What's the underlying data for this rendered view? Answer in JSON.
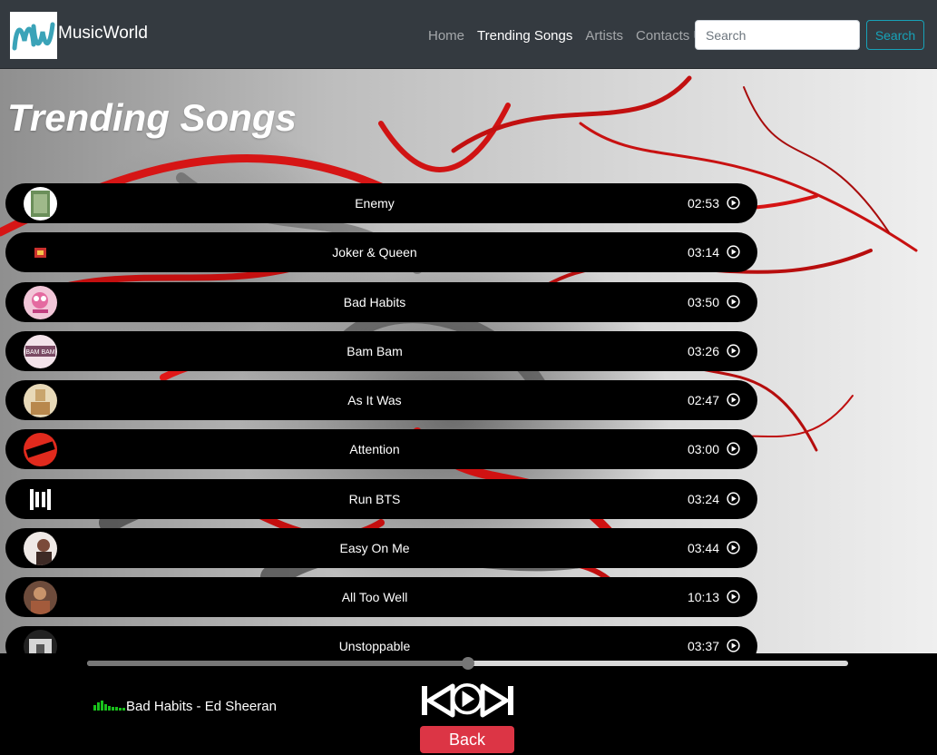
{
  "brand": {
    "name": "MusicWorld",
    "logo_text": "MW"
  },
  "nav": {
    "links": [
      {
        "label": "Home",
        "active": false
      },
      {
        "label": "Trending Songs",
        "active": true
      },
      {
        "label": "Artists",
        "active": false
      },
      {
        "label": "Contacts Us",
        "active": false
      }
    ],
    "search_placeholder": "Search",
    "search_button": "Search"
  },
  "page": {
    "title": "Trending Songs"
  },
  "songs": [
    {
      "title": "Enemy",
      "duration": "02:53"
    },
    {
      "title": "Joker & Queen",
      "duration": "03:14"
    },
    {
      "title": "Bad Habits",
      "duration": "03:50"
    },
    {
      "title": "Bam Bam",
      "duration": "03:26"
    },
    {
      "title": "As It Was",
      "duration": "02:47"
    },
    {
      "title": "Attention",
      "duration": "03:00"
    },
    {
      "title": "Run BTS",
      "duration": "03:24"
    },
    {
      "title": "Easy On Me",
      "duration": "03:44"
    },
    {
      "title": "All Too Well",
      "duration": "10:13"
    },
    {
      "title": "Unstoppable",
      "duration": "03:37"
    }
  ],
  "player": {
    "now_playing": "Bad Habits - Ed Sheeran",
    "progress_fraction": 0.5,
    "back_label": "Back",
    "controls": [
      "previous-icon",
      "play-icon",
      "next-icon"
    ]
  },
  "colors": {
    "navbar": "#343a40",
    "accent": "#17a2b8",
    "back_button": "#dc3545",
    "row": "#000000"
  }
}
